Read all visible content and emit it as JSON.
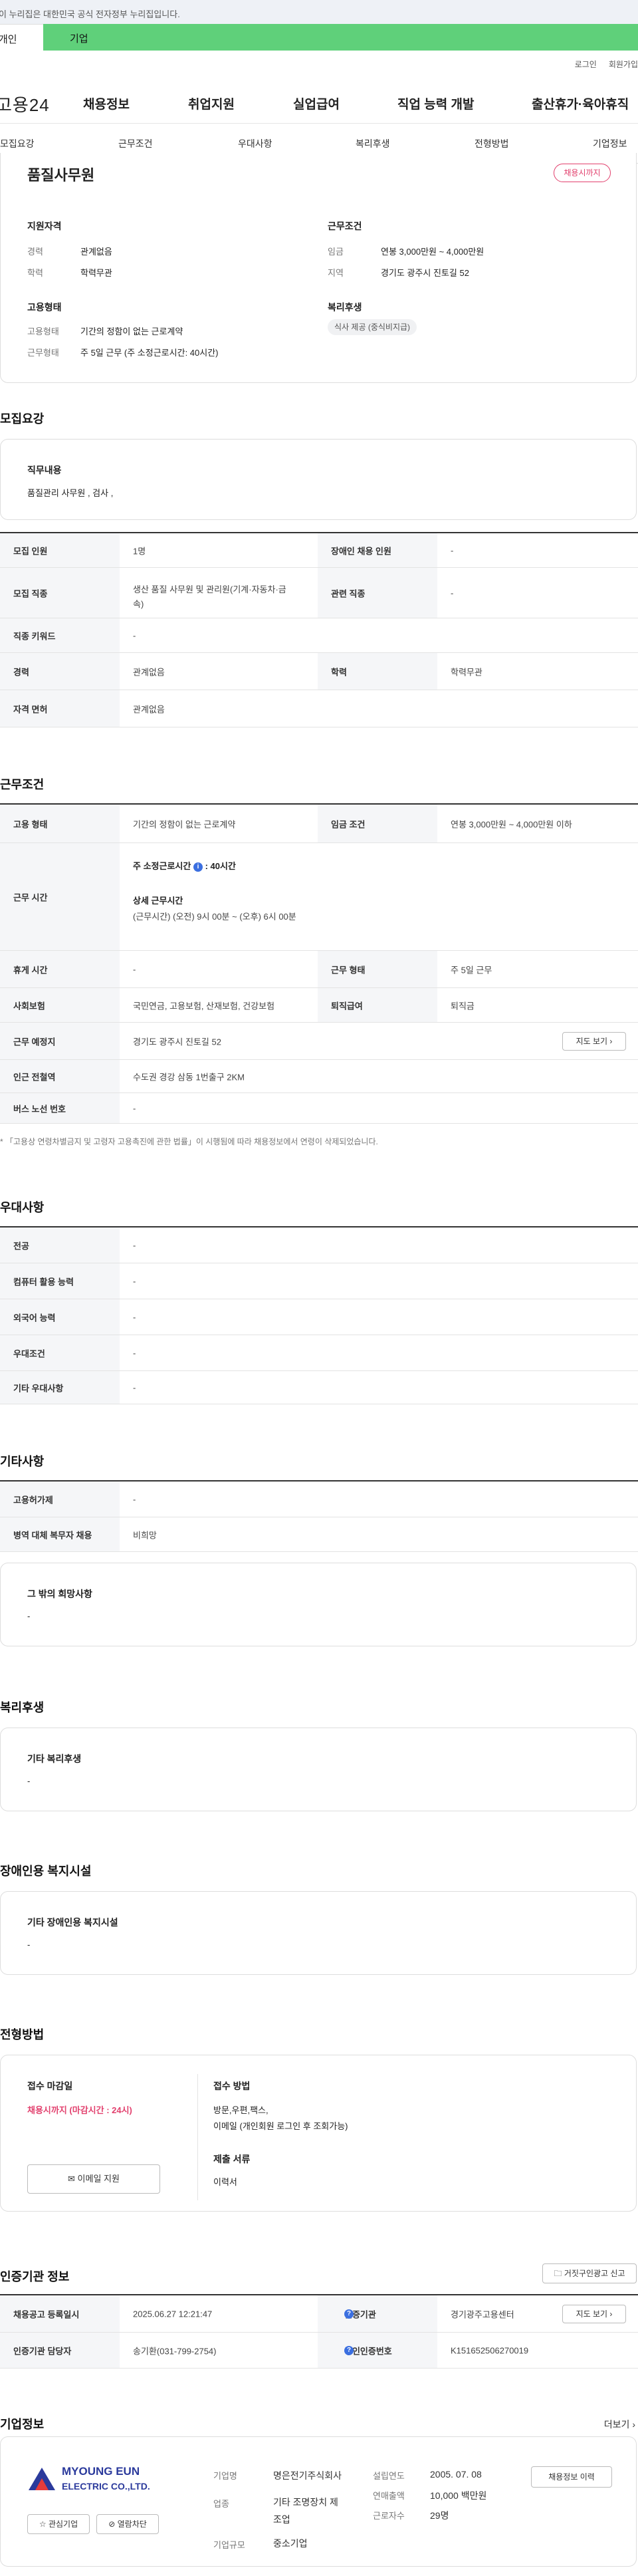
{
  "gov_banner": "이 누리집은 대한민국 공식 전자정부 누리집입니다.",
  "top_tabs": {
    "personal": "개인",
    "company": "기업"
  },
  "util_links": {
    "login": "로그인",
    "join": "회원가입"
  },
  "logo": "고용24",
  "gnb": [
    "채용정보",
    "취업지원",
    "실업급여",
    "직업 능력 개발",
    "출산휴가·육아휴직"
  ],
  "subnav": [
    "모집요강",
    "근무조건",
    "우대사항",
    "복리후생",
    "전형방법",
    "기업정보"
  ],
  "summary": {
    "title": "품질사무원",
    "status": "채용시까지",
    "qualification_title": "지원자격",
    "career_label": "경력",
    "career": "관계없음",
    "edu_label": "학력",
    "edu": "학력무관",
    "work_cond_title": "근무조건",
    "wage_label": "임금",
    "wage": "연봉 3,000만원 ~ 4,000만원",
    "region_label": "지역",
    "region": "경기도 광주시 진토길 52",
    "employ_title": "고용형태",
    "employ_type_label": "고용형태",
    "employ_type": "기간의 정함이 없는 근로계약",
    "work_form_label": "근무형태",
    "work_form": "주 5일 근무 (주 소정근로시간: 40시간)",
    "welfare_title": "복리후생",
    "welfare_tag": "식사 제공 (중식비지급)"
  },
  "recruit": {
    "title": "모집요강",
    "duty_title": "직무내용",
    "duty": "품질관리 사무원 , 검사 ,",
    "headcount_label": "모집 인원",
    "headcount": "1명",
    "disabled_label": "장애인 채용 인원",
    "disabled": "-",
    "job_label": "모집 직종",
    "job_line1": "생산 품질 사무원 및 관리원(기계·자동차·금",
    "job_line2": "속)",
    "related_label": "관련 직종",
    "related": "-",
    "keyword_label": "직종 키워드",
    "keyword": "-",
    "career_label": "경력",
    "career": "관계없음",
    "edu_label": "학력",
    "edu": "학력무관",
    "license_label": "자격 면허",
    "license": "관계없음"
  },
  "conditions": {
    "title": "근무조건",
    "employ_label": "고용 형태",
    "employ": "기간의 정함이 없는 근로계약",
    "wage_label": "임금 조건",
    "wage": "연봉 3,000만원 ~ 4,000만원 이하",
    "hours_label": "근무 시간",
    "weekly": "주 소정근로시간",
    "weekly_val": ": 40시간",
    "detail_title": "상세 근무시간",
    "detail": "(근무시간) (오전) 9시 00분 ~ (오후) 6시 00분",
    "rest_label": "휴게 시간",
    "rest": "-",
    "workform_label": "근무 형태",
    "workform": "주 5일 근무",
    "insurance_label": "사회보험",
    "insurance": "국민연금, 고용보험, 산재보험, 건강보험",
    "retire_label": "퇴직급여",
    "retire": "퇴직금",
    "place_label": "근무 예정지",
    "place": "경기도 광주시 진토길 52",
    "map_btn": "지도 보기",
    "subway_label": "인근 전철역",
    "subway": "수도권 경강 삼동 1번출구 2KM",
    "bus_label": "버스 노선 번호",
    "bus": "-",
    "note": "* 「고용상 연령차별금지 및 고령자 고용촉진에 관한 법률」이 시행됨에 따라 채용정보에서 연령이 삭제되었습니다."
  },
  "preference": {
    "title": "우대사항",
    "rows": [
      {
        "label": "전공",
        "value": "-"
      },
      {
        "label": "컴퓨터 활용 능력",
        "value": "-"
      },
      {
        "label": "외국어 능력",
        "value": "-"
      },
      {
        "label": "우대조건",
        "value": "-"
      },
      {
        "label": "기타 우대사항",
        "value": "-"
      }
    ]
  },
  "etc": {
    "title": "기타사항",
    "rows": [
      {
        "label": "고용허가제",
        "value": "-"
      },
      {
        "label": "병역 대체 복무자 채용",
        "value": "비희망"
      }
    ],
    "other_title": "그 밖의 희망사항",
    "other": "-"
  },
  "welfare": {
    "title": "복리후생",
    "box_title": "기타 복리후생",
    "box_value": "-"
  },
  "disabled_facility": {
    "title": "장애인용 복지시설",
    "box_title": "기타 장애인용 복지시설",
    "box_value": "-"
  },
  "selection": {
    "title": "전형방법",
    "deadline_title": "접수 마감일",
    "deadline": "채용시까지 (마감시간 : 24시)",
    "method_title": "접수 방법",
    "method1": "방문,우편,팩스,",
    "method2": "이메일 (개인회원 로그인 후 조회가능)",
    "docs_title": "제출 서류",
    "docs": "이력서",
    "email_btn": "이메일 지원"
  },
  "agency": {
    "title": "인증기관 정보",
    "report_btn": "거짓구인광고 신고",
    "reg_label": "채용공고 등록일시",
    "reg": "2025.06.27 12:21:47",
    "org_label": "인증기관",
    "org": "경기광주고용센터",
    "map_btn": "지도 보기",
    "manager_label": "인증기관 담당자",
    "manager": "송기환(031-799-2754)",
    "num_label": "구인인증번호",
    "num": "K151652506270019"
  },
  "company": {
    "title": "기업정보",
    "more": "더보기",
    "logo_line1": "MYOUNG EUN",
    "logo_line2": "ELECTRIC CO.,LTD.",
    "interest_btn": "관심기업",
    "block_btn": "열람차단",
    "name_label": "기업명",
    "name": "명은전기주식회사",
    "industry_label": "업종",
    "industry_line1": "기타 조명장치 제",
    "industry_line2": "조업",
    "size_label": "기업규모",
    "size": "중소기업",
    "founded_label": "설립연도",
    "founded": "2005. 07. 08",
    "sales_label": "연매출액",
    "sales": "10,000 백만원",
    "employees_label": "근로자수",
    "employees": "29명",
    "history_btn": "채용정보 이력"
  },
  "colors": {
    "accent": "#5fd07a",
    "status": "#e2416e",
    "info": "#3b6fe0"
  }
}
